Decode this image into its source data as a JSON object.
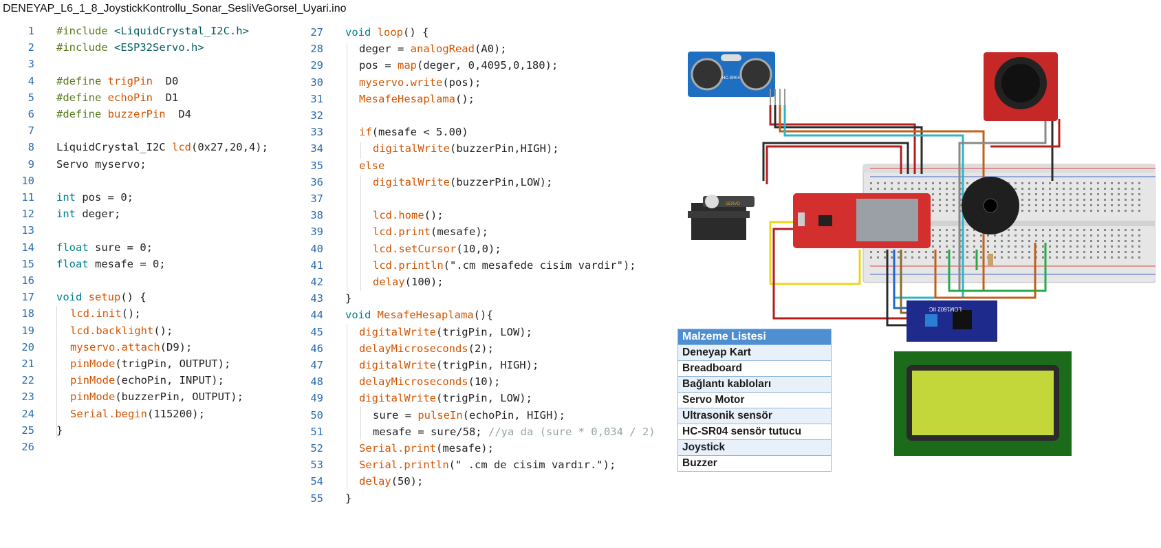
{
  "file_title": "DENEYAP_L6_1_8_JoystickKontrollu_Sonar_SesliVeGorsel_Uyari.ino",
  "left_code": [
    {
      "n": "1",
      "t": [
        [
          "k-pre",
          "#include "
        ],
        [
          "k-str",
          "<LiquidCrystal_I2C.h>"
        ]
      ],
      "i": 0
    },
    {
      "n": "2",
      "t": [
        [
          "k-pre",
          "#include "
        ],
        [
          "k-str",
          "<ESP32Servo.h>"
        ]
      ],
      "i": 0
    },
    {
      "n": "3",
      "t": [],
      "i": 0
    },
    {
      "n": "4",
      "t": [
        [
          "k-pre",
          "#define "
        ],
        [
          "k-def",
          "trigPin"
        ],
        [
          "",
          "  D0"
        ]
      ],
      "i": 0
    },
    {
      "n": "5",
      "t": [
        [
          "k-pre",
          "#define "
        ],
        [
          "k-def",
          "echoPin"
        ],
        [
          "",
          "  D1"
        ]
      ],
      "i": 0
    },
    {
      "n": "6",
      "t": [
        [
          "k-pre",
          "#define "
        ],
        [
          "k-def",
          "buzzerPin"
        ],
        [
          "",
          "  D4"
        ]
      ],
      "i": 0
    },
    {
      "n": "7",
      "t": [],
      "i": 0
    },
    {
      "n": "8",
      "t": [
        [
          "",
          "LiquidCrystal_I2C "
        ],
        [
          "k-fn",
          "lcd"
        ],
        [
          "",
          "(0x27,20,4);"
        ]
      ],
      "i": 0
    },
    {
      "n": "9",
      "t": [
        [
          "",
          "Servo myservo;"
        ]
      ],
      "i": 0
    },
    {
      "n": "10",
      "t": [],
      "i": 0
    },
    {
      "n": "11",
      "t": [
        [
          "k-type",
          "int"
        ],
        [
          "",
          " pos = 0;"
        ]
      ],
      "i": 0
    },
    {
      "n": "12",
      "t": [
        [
          "k-type",
          "int"
        ],
        [
          "",
          " deger;"
        ]
      ],
      "i": 0
    },
    {
      "n": "13",
      "t": [],
      "i": 0
    },
    {
      "n": "14",
      "t": [
        [
          "k-type",
          "float"
        ],
        [
          "",
          " sure = 0;"
        ]
      ],
      "i": 0
    },
    {
      "n": "15",
      "t": [
        [
          "k-type",
          "float"
        ],
        [
          "",
          " mesafe = 0;"
        ]
      ],
      "i": 0
    },
    {
      "n": "16",
      "t": [],
      "i": 0
    },
    {
      "n": "17",
      "t": [
        [
          "k-type",
          "void"
        ],
        [
          "",
          " "
        ],
        [
          "k-fn",
          "setup"
        ],
        [
          "",
          "() {"
        ]
      ],
      "i": 0
    },
    {
      "n": "18",
      "t": [
        [
          "k-fn",
          "lcd.init"
        ],
        [
          "",
          "();"
        ]
      ],
      "i": 1
    },
    {
      "n": "19",
      "t": [
        [
          "k-fn",
          "lcd.backlight"
        ],
        [
          "",
          "();"
        ]
      ],
      "i": 1
    },
    {
      "n": "20",
      "t": [
        [
          "k-fn",
          "myservo.attach"
        ],
        [
          "",
          "(D9);"
        ]
      ],
      "i": 1
    },
    {
      "n": "21",
      "t": [
        [
          "k-fn",
          "pinMode"
        ],
        [
          "",
          "(trigPin, OUTPUT);"
        ]
      ],
      "i": 1
    },
    {
      "n": "22",
      "t": [
        [
          "k-fn",
          "pinMode"
        ],
        [
          "",
          "(echoPin, INPUT);"
        ]
      ],
      "i": 1
    },
    {
      "n": "23",
      "t": [
        [
          "k-fn",
          "pinMode"
        ],
        [
          "",
          "(buzzerPin, OUTPUT);"
        ]
      ],
      "i": 1
    },
    {
      "n": "24",
      "t": [
        [
          "k-fn",
          "Serial.begin"
        ],
        [
          "",
          "(115200);"
        ]
      ],
      "i": 1
    },
    {
      "n": "25",
      "t": [
        [
          "",
          "}"
        ]
      ],
      "i": 0
    },
    {
      "n": "26",
      "t": [],
      "i": 0
    }
  ],
  "right_code": [
    {
      "n": "27",
      "t": [
        [
          "k-type",
          "void"
        ],
        [
          "",
          " "
        ],
        [
          "k-fn",
          "loop"
        ],
        [
          "",
          "() {"
        ]
      ],
      "i": 0
    },
    {
      "n": "28",
      "t": [
        [
          "",
          "deger = "
        ],
        [
          "k-fn",
          "analogRead"
        ],
        [
          "",
          "(A0);"
        ]
      ],
      "i": 1
    },
    {
      "n": "29",
      "t": [
        [
          "",
          "pos = "
        ],
        [
          "k-fn",
          "map"
        ],
        [
          "",
          "(deger, 0,4095,0,180);"
        ]
      ],
      "i": 1
    },
    {
      "n": "30",
      "t": [
        [
          "k-fn",
          "myservo.write"
        ],
        [
          "",
          "(pos);"
        ]
      ],
      "i": 1
    },
    {
      "n": "31",
      "t": [
        [
          "k-fn",
          "MesafeHesaplama"
        ],
        [
          "",
          "();"
        ]
      ],
      "i": 1
    },
    {
      "n": "32",
      "t": [],
      "i": 1
    },
    {
      "n": "33",
      "t": [
        [
          "k-fn",
          "if"
        ],
        [
          "",
          "(mesafe < 5.00)"
        ]
      ],
      "i": 1
    },
    {
      "n": "34",
      "t": [
        [
          "k-fn",
          "digitalWrite"
        ],
        [
          "",
          "(buzzerPin,HIGH);"
        ]
      ],
      "i": 2
    },
    {
      "n": "35",
      "t": [
        [
          "k-fn",
          "else"
        ]
      ],
      "i": 1
    },
    {
      "n": "36",
      "t": [
        [
          "k-fn",
          "digitalWrite"
        ],
        [
          "",
          "(buzzerPin,LOW);"
        ]
      ],
      "i": 2
    },
    {
      "n": "37",
      "t": [],
      "i": 2
    },
    {
      "n": "38",
      "t": [
        [
          "k-fn",
          "lcd.home"
        ],
        [
          "",
          "();"
        ]
      ],
      "i": 2
    },
    {
      "n": "39",
      "t": [
        [
          "k-fn",
          "lcd.print"
        ],
        [
          "",
          "(mesafe);"
        ]
      ],
      "i": 2
    },
    {
      "n": "40",
      "t": [
        [
          "k-fn",
          "lcd.setCursor"
        ],
        [
          "",
          "(10,0);"
        ]
      ],
      "i": 2
    },
    {
      "n": "41",
      "t": [
        [
          "k-fn",
          "lcd.println"
        ],
        [
          "",
          "(\".cm mesafede cisim vardir\");"
        ]
      ],
      "i": 2
    },
    {
      "n": "42",
      "t": [
        [
          "k-fn",
          "delay"
        ],
        [
          "",
          "(100);"
        ]
      ],
      "i": 2
    },
    {
      "n": "43",
      "t": [
        [
          "",
          "}"
        ]
      ],
      "i": 0
    },
    {
      "n": "44",
      "t": [
        [
          "k-type",
          "void"
        ],
        [
          "",
          " "
        ],
        [
          "k-fn",
          "MesafeHesaplama"
        ],
        [
          "",
          "(){"
        ]
      ],
      "i": 0
    },
    {
      "n": "45",
      "t": [
        [
          "k-fn",
          "digitalWrite"
        ],
        [
          "",
          "(trigPin, LOW);"
        ]
      ],
      "i": 1
    },
    {
      "n": "46",
      "t": [
        [
          "k-fn",
          "delayMicroseconds"
        ],
        [
          "",
          "(2);"
        ]
      ],
      "i": 1
    },
    {
      "n": "47",
      "t": [
        [
          "k-fn",
          "digitalWrite"
        ],
        [
          "",
          "(trigPin, HIGH);"
        ]
      ],
      "i": 1
    },
    {
      "n": "48",
      "t": [
        [
          "k-fn",
          "delayMicroseconds"
        ],
        [
          "",
          "(10);"
        ]
      ],
      "i": 1
    },
    {
      "n": "49",
      "t": [
        [
          "k-fn",
          "digitalWrite"
        ],
        [
          "",
          "(trigPin, LOW);"
        ]
      ],
      "i": 1
    },
    {
      "n": "50",
      "t": [
        [
          "",
          "sure = "
        ],
        [
          "k-fn",
          "pulseIn"
        ],
        [
          "",
          "(echoPin, HIGH);"
        ]
      ],
      "i": 2
    },
    {
      "n": "51",
      "t": [
        [
          "",
          "mesafe = sure/58; "
        ],
        [
          "k-cmt",
          "//ya da (sure * 0,034 / 2)"
        ]
      ],
      "i": 2
    },
    {
      "n": "52",
      "t": [
        [
          "k-fn",
          "Serial.print"
        ],
        [
          "",
          "(mesafe);"
        ]
      ],
      "i": 1
    },
    {
      "n": "53",
      "t": [
        [
          "k-fn",
          "Serial.println"
        ],
        [
          "",
          "(\" .cm de cisim vardır.\");"
        ]
      ],
      "i": 1
    },
    {
      "n": "54",
      "t": [
        [
          "k-fn",
          "delay"
        ],
        [
          "",
          "(50);"
        ]
      ],
      "i": 1
    },
    {
      "n": "55",
      "t": [
        [
          "",
          "}"
        ]
      ],
      "i": 0
    }
  ],
  "bom": {
    "header": "Malzeme Listesi",
    "items": [
      "Deneyap Kart",
      "Breadboard",
      "Bağlantı kabloları",
      "Servo Motor",
      "Ultrasonik sensör",
      "HC-SR04 sensör tutucu",
      "Joystick",
      "Buzzer"
    ]
  },
  "circuit_labels": {
    "servo": "SERVO",
    "lcd_module": "LCM1602 IIC",
    "sonar": "HC-SR04"
  }
}
